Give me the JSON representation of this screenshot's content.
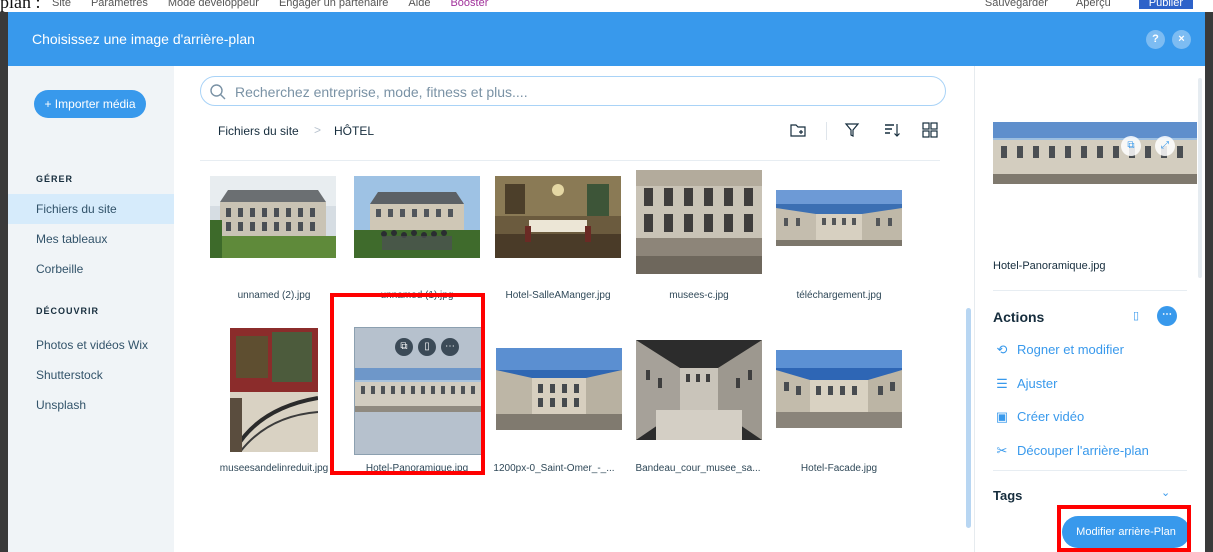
{
  "editor": {
    "top_caption": "plan :",
    "menu": [
      "Site",
      "Paramètres",
      "Mode développeur",
      "Engager un partenaire",
      "Aide",
      "Booster"
    ],
    "right": [
      "Sauvegarder",
      "Aperçu",
      "Publier"
    ]
  },
  "modal": {
    "title": "Choisissez une image d'arrière-plan",
    "help_icon": "?",
    "close_icon": "×"
  },
  "sidebar": {
    "import_label": "+ Importer média",
    "manage_header": "GÉRER",
    "manage_items": [
      "Fichiers du site",
      "Mes tableaux",
      "Corbeille"
    ],
    "discover_header": "DÉCOUVRIR",
    "discover_items": [
      "Photos et vidéos Wix",
      "Shutterstock",
      "Unsplash"
    ],
    "active_item": "Fichiers du site"
  },
  "search": {
    "placeholder": "Recherchez entreprise, mode, fitness et plus...."
  },
  "breadcrumb": {
    "root": "Fichiers du site",
    "separator": ">",
    "current": "HÔTEL"
  },
  "toolbar_icons": [
    "new-folder-icon",
    "filter-icon",
    "sort-icon",
    "grid-view-icon"
  ],
  "files": [
    {
      "name": "unnamed (2).jpg"
    },
    {
      "name": "unnamed (1).jpg"
    },
    {
      "name": "Hotel-SalleAManger.jpg"
    },
    {
      "name": "musees-c.jpg"
    },
    {
      "name": "téléchargement.jpg"
    },
    {
      "name": "museesandelinreduit.jpg"
    },
    {
      "name": "Hotel-Panoramique.jpg",
      "selected": true
    },
    {
      "name": "1200px-0_Saint-Omer_-_..."
    },
    {
      "name": "Bandeau_cour_musee_sa..."
    },
    {
      "name": "Hotel-Facade.jpg"
    }
  ],
  "details": {
    "filename": "Hotel-Panoramique.jpg",
    "actions_title": "Actions",
    "actions": [
      "Rogner et modifier",
      "Ajuster",
      "Créer vidéo",
      "Découper l'arrière-plan"
    ],
    "tags_title": "Tags"
  },
  "apply_button": "Modifier arrière-Plan",
  "colors": {
    "accent": "#3899ec",
    "highlight": "#ff0000",
    "sidebar_bg": "#f0f4f7"
  }
}
